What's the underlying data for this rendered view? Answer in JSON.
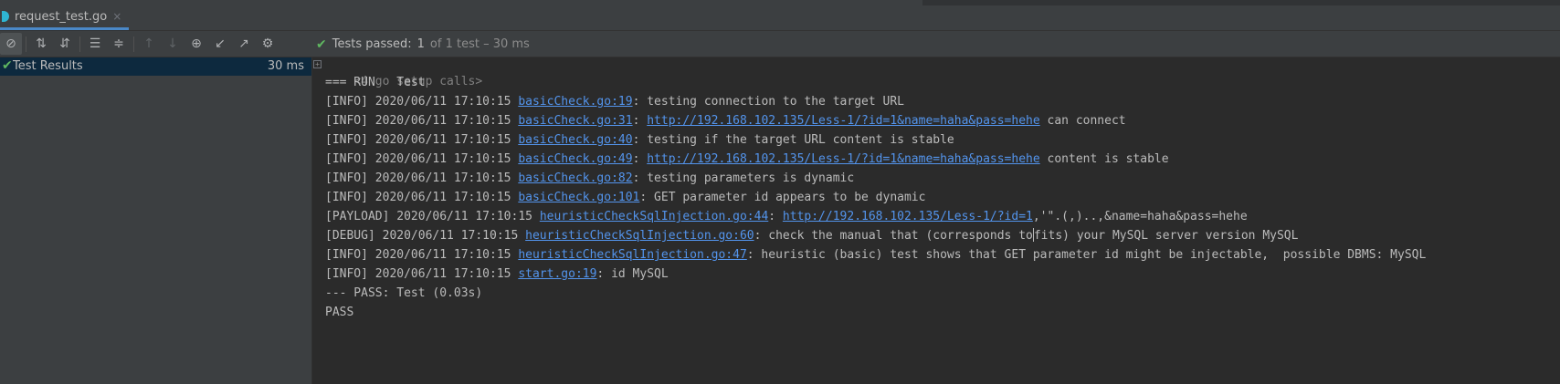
{
  "tab": {
    "filename": "request_test.go",
    "close": "×"
  },
  "toolbar": {
    "buttons": [
      "stop-rerun",
      "sort-alpha",
      "sort-duration",
      "expand-all",
      "collapse-all",
      "prev-failed",
      "next-failed",
      "history",
      "import",
      "export",
      "settings"
    ]
  },
  "status": {
    "check": "✔",
    "label": "Tests passed:",
    "count": "1",
    "detail": "of 1 test – 30 ms"
  },
  "tree": {
    "label": "Test Results",
    "duration": "30 ms"
  },
  "console": {
    "fold_label": "<4 go setup calls>",
    "run_line": "=== RUN   Test",
    "logs": [
      {
        "prefix": "[INFO] 2020/06/11 17:10:15 ",
        "file": "basicCheck.go:19",
        "mid": ": testing connection to the target URL",
        "url": "",
        "suffix": ""
      },
      {
        "prefix": "[INFO] 2020/06/11 17:10:15 ",
        "file": "basicCheck.go:31",
        "mid": ": ",
        "url": "http://192.168.102.135/Less-1/?id=1&name=haha&pass=hehe",
        "suffix": " can connect"
      },
      {
        "prefix": "[INFO] 2020/06/11 17:10:15 ",
        "file": "basicCheck.go:40",
        "mid": ": testing if the target URL content is stable",
        "url": "",
        "suffix": ""
      },
      {
        "prefix": "[INFO] 2020/06/11 17:10:15 ",
        "file": "basicCheck.go:49",
        "mid": ": ",
        "url": "http://192.168.102.135/Less-1/?id=1&name=haha&pass=hehe",
        "suffix": " content is stable"
      },
      {
        "prefix": "[INFO] 2020/06/11 17:10:15 ",
        "file": "basicCheck.go:82",
        "mid": ": testing parameters is dynamic",
        "url": "",
        "suffix": ""
      },
      {
        "prefix": "[INFO] 2020/06/11 17:10:15 ",
        "file": "basicCheck.go:101",
        "mid": ": GET parameter id appears to be dynamic",
        "url": "",
        "suffix": ""
      },
      {
        "prefix": "[PAYLOAD] 2020/06/11 17:10:15 ",
        "file": "heuristicCheckSqlInjection.go:44",
        "mid": ": ",
        "url": "http://192.168.102.135/Less-1/?id=1",
        "suffix": ",'\".(,)..,&name=haha&pass=hehe"
      },
      {
        "prefix": "[DEBUG] 2020/06/11 17:10:15 ",
        "file": "heuristicCheckSqlInjection.go:60",
        "mid": ": check the manual that (corresponds to",
        "url": "",
        "suffix": "fits) your MySQL server version MySQL"
      },
      {
        "prefix": "[INFO] 2020/06/11 17:10:15 ",
        "file": "heuristicCheckSqlInjection.go:47",
        "mid": ": heuristic (basic) test shows that GET parameter id might be injectable,  possible DBMS: MySQL",
        "url": "",
        "suffix": ""
      },
      {
        "prefix": "[INFO] 2020/06/11 17:10:15 ",
        "file": "start.go:19",
        "mid": ": id MySQL",
        "url": "",
        "suffix": ""
      }
    ],
    "pass_line": "--- PASS: Test (0.03s)",
    "final_line": "PASS"
  }
}
